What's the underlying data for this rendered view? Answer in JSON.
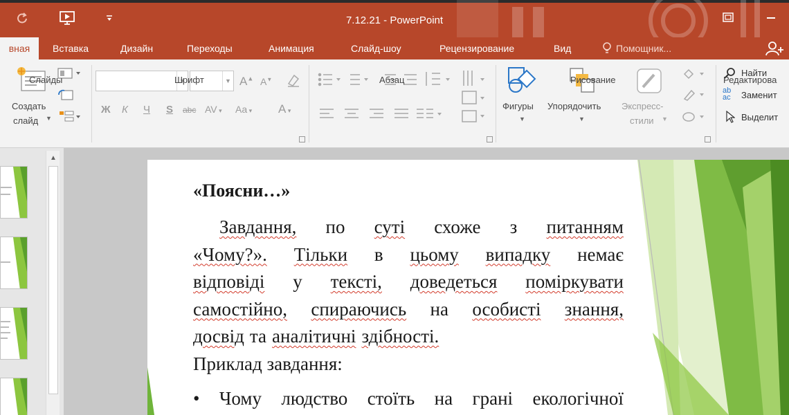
{
  "window": {
    "title": "7.12.21 - PowerPoint",
    "restore_icon": "restore-icon",
    "minimize_icon": "minimize-icon"
  },
  "quick_access": {
    "undo_icon": "undo-icon",
    "present_icon": "slideshow-from-start-icon",
    "customize_icon": "customize-arrow-icon"
  },
  "tabs": [
    {
      "label": "вная",
      "active": true
    },
    {
      "label": "Вставка"
    },
    {
      "label": "Дизайн"
    },
    {
      "label": "Переходы"
    },
    {
      "label": "Анимация"
    },
    {
      "label": "Слайд-шоу"
    },
    {
      "label": "Рецензирование"
    },
    {
      "label": "Вид"
    }
  ],
  "help": {
    "label": "Помощник...",
    "icon": "lightbulb-icon"
  },
  "ribbon": {
    "slides": {
      "label": "Слайды",
      "new_slide_line1": "Создать",
      "new_slide_line2": "слайд"
    },
    "font": {
      "label": "Шрифт",
      "bold": "Ж",
      "italic": "К",
      "underline": "Ч",
      "shadow": "S",
      "strike": "abc",
      "spacing": "AV",
      "case": "Aa",
      "color": "A",
      "grow": "A",
      "shrink": "A"
    },
    "paragraph": {
      "label": "Абзац"
    },
    "drawing": {
      "label": "Рисование",
      "shapes": "Фигуры",
      "arrange": "Упорядочить",
      "quick_styles_line1": "Экспресс-",
      "quick_styles_line2": "стили"
    },
    "editing": {
      "label": "Редактирова",
      "find": "Найти",
      "replace": "Заменит",
      "select": "Выделит"
    }
  },
  "slide": {
    "heading": "«Поясни…»",
    "paragraph_lines": [
      [
        "Завдання,",
        "по",
        "суті",
        "схоже",
        "з",
        "питанням"
      ],
      [
        "«Чому?».",
        "Тільки",
        "в",
        "цьому",
        "випадку",
        "немає"
      ],
      [
        "відповіді",
        "у",
        "тексті,",
        "доведеться",
        "поміркувати"
      ],
      [
        "самостійно,",
        "спираючись",
        "на",
        "особисті",
        "знання,"
      ],
      [
        "досвід",
        "та",
        "аналітичні",
        "здібності."
      ]
    ],
    "example_label": "Приклад завдання:",
    "bullet": "•",
    "bullet_words": [
      "Чому",
      "людство",
      "стоїть",
      "на",
      "грані",
      "екологічної"
    ]
  },
  "colors": {
    "accent": "#b7472a",
    "ribbon_bg": "#f3f3f3",
    "slide_green": "#6fb43a",
    "spell_underline": "#d23a2a"
  }
}
